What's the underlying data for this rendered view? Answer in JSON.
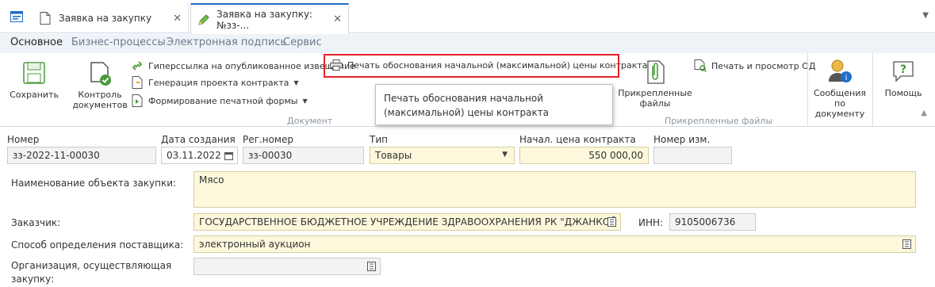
{
  "tabs": [
    {
      "label": "Заявка на закупку"
    },
    {
      "label": "Заявка на закупку: №зз-..."
    }
  ],
  "ribbon_tabs": [
    "Основное",
    "Бизнес-процессы",
    "Электронная подпись",
    "Сервис"
  ],
  "ribbon": {
    "save": "Сохранить",
    "control_docs_1": "Контроль",
    "control_docs_2": "документов",
    "hyperlink": "Гиперссылка на опубликованное извещение",
    "gen_project": "Генерация проекта контракта",
    "print_form": "Формирование печатной формы",
    "print_justification": "Печать обоснования начальной (максимальной) цены контракта",
    "attached_1": "Прикрепленные",
    "attached_2": "файлы",
    "print_view_od": "Печать и просмотр ОД",
    "messages_1": "Сообщения по",
    "messages_2": "документу",
    "help": "Помощь",
    "group_document": "Документ",
    "group_attached": "Прикрепленные файлы",
    "tooltip": "Печать обоснования начальной (максимальной) цены контракта"
  },
  "form": {
    "number_label": "Номер",
    "number_value": "зз-2022-11-00030",
    "created_label": "Дата создания",
    "created_value": "03.11.2022",
    "regnum_label": "Рег.номер",
    "regnum_value": "зз-00030",
    "type_label": "Тип",
    "type_value": "Товары",
    "price_label": "Начал. цена контракта",
    "price_value": "550 000,00",
    "change_label": "Номер изм.",
    "change_value": "",
    "object_label": "Наименование объекта закупки:",
    "object_value": "Мясо",
    "customer_label": "Заказчик:",
    "customer_value": "ГОСУДАРСТВЕННОЕ БЮДЖЕТНОЕ УЧРЕЖДЕНИЕ ЗДРАВООХРАНЕНИЯ РК \"ДЖАНКОЙ",
    "inn_label": "ИНН:",
    "inn_value": "9105006736",
    "method_label": "Способ определения поставщика:",
    "method_value": "электронный аукцион",
    "org_label_1": "Организация, осуществляющая",
    "org_label_2": "закупку:",
    "org_value": ""
  },
  "colors": {
    "highlight": "#e2222b",
    "accent": "#1e6fc7",
    "yellow_field": "#fdf8dc"
  }
}
